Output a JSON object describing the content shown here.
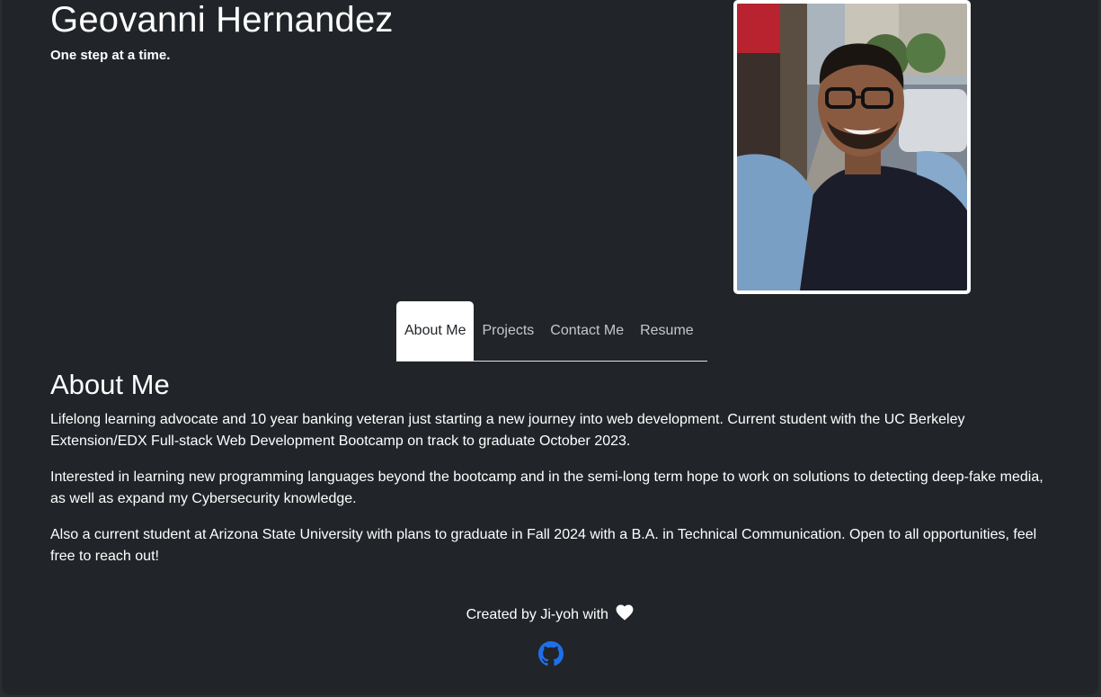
{
  "header": {
    "name": "Geovanni Hernandez",
    "tagline": "One step at a time."
  },
  "nav": {
    "tabs": [
      {
        "label": "About Me",
        "active": true
      },
      {
        "label": "Projects",
        "active": false
      },
      {
        "label": "Contact Me",
        "active": false
      },
      {
        "label": "Resume",
        "active": false
      }
    ]
  },
  "about": {
    "title": "About Me",
    "paragraphs": [
      "Lifelong learning advocate and 10 year banking veteran just starting a new journey into web development. Current student with the UC Berkeley Extension/EDX Full-stack Web Development Bootcamp on track to graduate October 2023.",
      "Interested in learning new programming languages beyond the bootcamp and in the semi-long term hope to work on solutions to detecting deep-fake media, as well as expand my Cybersecurity knowledge.",
      "Also a current student at Arizona State University with plans to graduate in Fall 2024 with a B.A. in Technical Communication. Open to all opportunities, feel free to reach out!"
    ]
  },
  "footer": {
    "text": "Created by Ji-yoh with",
    "heart_icon": "heart-icon",
    "github_icon": "github-icon"
  },
  "colors": {
    "background": "#212529",
    "text": "#ffffff",
    "tab_inactive": "#c4c8cc",
    "github_blue": "#1f6feb"
  }
}
